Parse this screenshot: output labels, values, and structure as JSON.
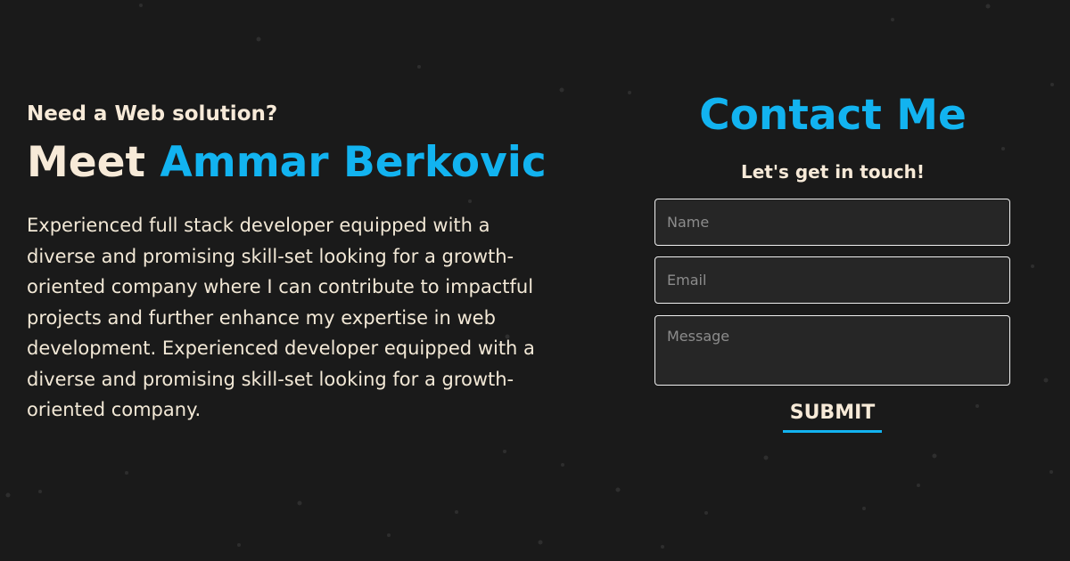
{
  "hero": {
    "eyebrow": "Need a Web solution?",
    "headline_prefix": "Meet ",
    "headline_name": "Ammar Berkovic",
    "bio": "Experienced full stack developer equipped with a diverse and promising skill-set looking for a growth-oriented company where I can contribute to impactful projects and further enhance my expertise in web development. Experienced developer equipped with a diverse and promising skill-set looking for a growth-oriented company."
  },
  "contact": {
    "title": "Contact Me",
    "subtitle": "Let's get in touch!",
    "fields": {
      "name_placeholder": "Name",
      "name_value": "",
      "email_placeholder": "Email",
      "email_value": "",
      "message_placeholder": "Message",
      "message_value": ""
    },
    "submit_label": "SUBMIT"
  },
  "colors": {
    "background": "#1a1a1a",
    "accent": "#12b3f0",
    "text": "#f7ead8",
    "field_background": "#262626"
  }
}
